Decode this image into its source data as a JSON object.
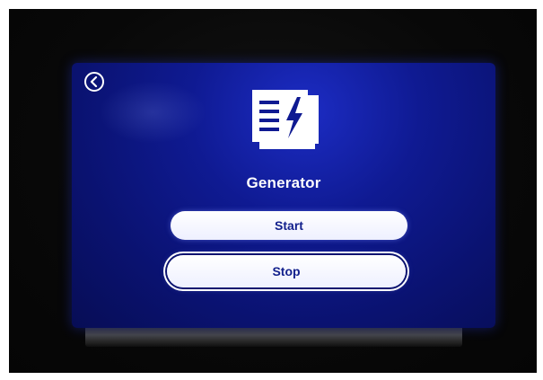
{
  "screen": {
    "title": "Generator",
    "back_icon": "chevron-left-circle-icon",
    "main_icon": "generator-lightning-icon"
  },
  "actions": {
    "start_label": "Start",
    "stop_label": "Stop"
  },
  "colors": {
    "screen_background": "#0f1a92",
    "foreground": "#ffffff",
    "button_text": "#12208c"
  }
}
